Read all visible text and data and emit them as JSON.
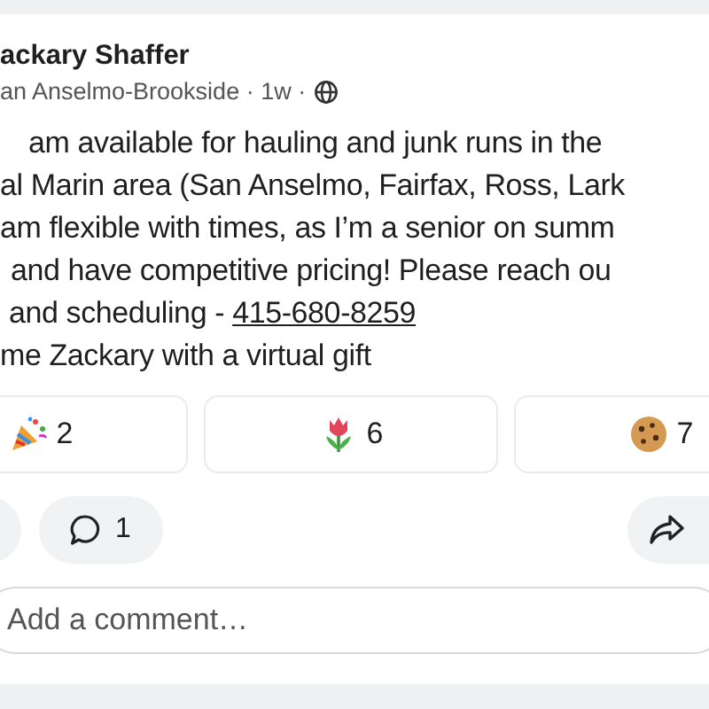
{
  "post": {
    "author": "ackary Shaffer",
    "meta": "an Anselmo-Brookside · 1w ·",
    "body_lines": [
      {
        "text": "am available for hauling and junk runs in the"
      },
      {
        "text": "al Marin area (San Anselmo, Fairfax, Ross, Lark"
      },
      {
        "text": "am flexible with times, as I’m a senior on summ"
      },
      {
        "text": "and have competitive pricing! Please reach ou"
      },
      {
        "text": "and scheduling - ",
        "link": "415-680-8259"
      },
      {
        "text": "me Zackary with a virtual gift"
      }
    ]
  },
  "gifts": [
    {
      "kind": "party",
      "count": "2"
    },
    {
      "kind": "tulip",
      "count": "6"
    },
    {
      "kind": "cookie",
      "count": "7"
    }
  ],
  "comments": {
    "count": "1"
  },
  "comment_field": {
    "placeholder": "Add a comment…"
  }
}
